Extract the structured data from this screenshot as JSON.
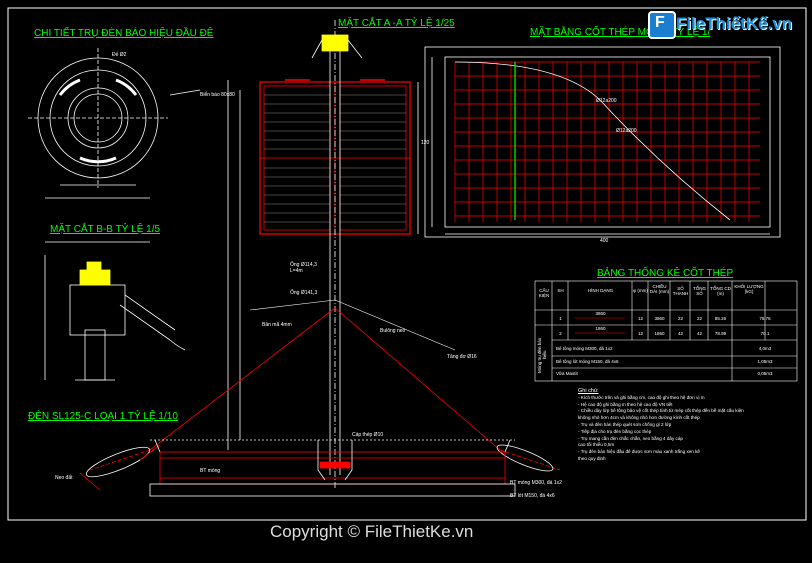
{
  "titles": {
    "detail_base": "CHI TIẾT TRỤ ĐÈN BÁO HIỆU ĐẦU ĐÊ",
    "section_aa": "MẶT CẮT A -A TỶ LỆ 1/25",
    "plan_rebar": "MẶT BẰNG CỐT THÉP MÓNG TỶ LỆ 1/",
    "section_bb": "MẶT CẮT B-B TỶ LỆ 1/5",
    "lamp": "ĐÈN SL125-C LOẠI 1 TỶ LỆ 1/10",
    "rebar_table": "BẢNG THỐNG KÊ CỐT THÉP"
  },
  "annotations": {
    "phi_base": "Đế Ø2",
    "dim_400": "400",
    "dim_120": "120",
    "rebar_top": "Ø12a200",
    "rebar_mid": "Ø12a200",
    "pole_pipe": "Ống Ø114,3",
    "pole_len": "L=4m",
    "pipe_141": "Ống Ø141,3",
    "stiffener": "Bản mã 4mm",
    "tie_rod": "Tăng đơ Ø16",
    "bolt": "Bulông neo",
    "foundation": "BT móng M300, đá 1x2",
    "lean_concrete": "BT lót M150, đá 4x6",
    "sign_note": "Biển báo 80x80",
    "anchor_note": "Neo đất",
    "concrete_note": "BT móng",
    "wire_note": "Cáp thép Ø10"
  },
  "table": {
    "headers": [
      "CẤU KIỆN",
      "SH",
      "HÌNH DẠNG",
      "φ (mm)",
      "CHIỀU DÀI (mm)",
      "SỐ THANH",
      "TỔNG SỐ",
      "TỔNG CD (m)",
      "KHỐI LƯỢNG (kG)"
    ],
    "group_label": "Móng trụ đèn báo hiệu",
    "rows": [
      {
        "sh": "1",
        "shape": "3860",
        "dia": "12",
        "len": "3860",
        "n": "22",
        "total": "22",
        "cd": "85.26",
        "kg": "75.76"
      },
      {
        "sh": "2",
        "shape": "1860",
        "dia": "12",
        "len": "1860",
        "n": "42",
        "total": "42",
        "cd": "78.99",
        "kg": "70.1"
      }
    ],
    "summary": [
      {
        "label": "Bê tông móng M300, đá 1x2",
        "value": "4,0m3"
      },
      {
        "label": "Bê tông lót móng M150, đá 4x6",
        "value": "1,05m3"
      },
      {
        "label": "Vữa Mastit",
        "value": "0,05m3"
      }
    ]
  },
  "notes": {
    "heading": "Ghi chú:",
    "lines": [
      "- Kích thước trên và ghi bằng cm, cao độ ghi theo hệ đơn vị m",
      "- Hệ cao độ ghi bằng m theo hệ cao độ VN tiết",
      "- Chiều dày lớp bê tông bảo vệ cốt thép tính từ mép cốt thép đến bề mặt cấu kiện",
      "  không nhỏ hơn 4cm và không nhỏ hơn đường kính cốt thép",
      "- Trụ và đèn hàn thép quét sơn chống gỉ 2 lớp",
      "- Tiếp địa cho trụ đèn bằng cọc thép",
      "- Trụ mang cần đèn chắc chắn, neo bằng 4 dây cáp",
      "  cao tối thiểu 0,5m",
      "- Trụ đèn báo hiệu đầu đê được sơn màu xanh trắng xen kẽ",
      "  theo quy định"
    ]
  },
  "logo": {
    "text": "FileThiếtKế.vn",
    "glyph": "F"
  },
  "copyright": "Copyright © FileThietKe.vn",
  "colors": {
    "background": "#000000",
    "title": "#00ff00",
    "line": "#ffffff",
    "red": "#ff0000",
    "yellow": "#ffff00",
    "logo": "#1a8fe0"
  }
}
